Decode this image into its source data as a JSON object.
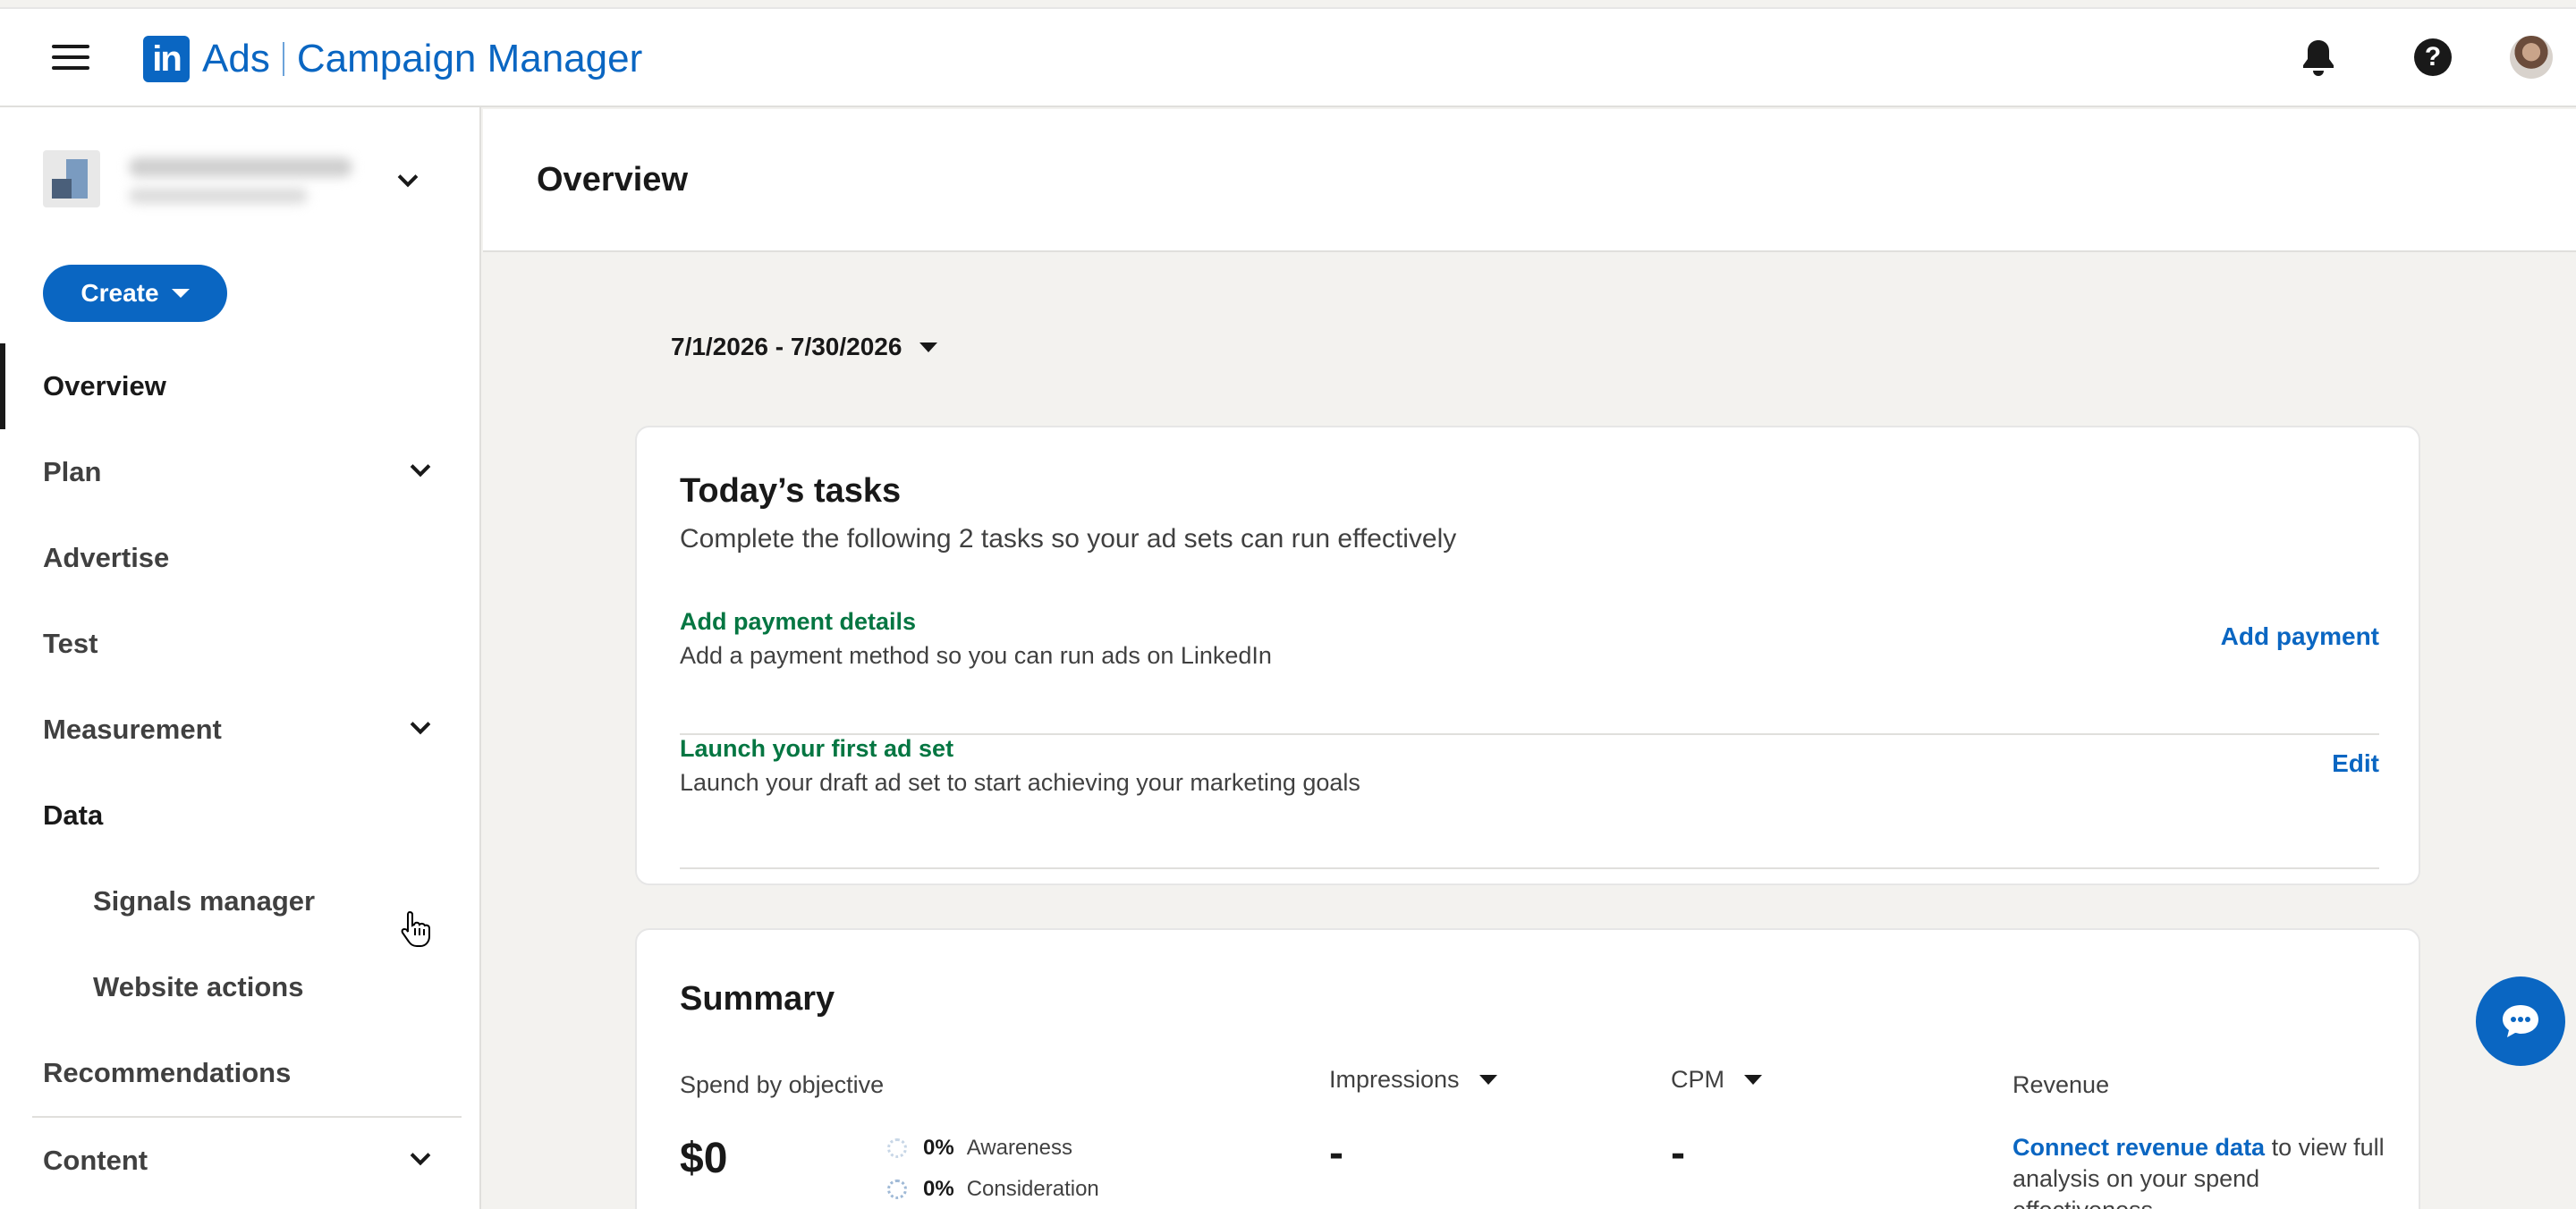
{
  "header": {
    "logo_text": "in",
    "brand_ads": "Ads",
    "brand_product": "Campaign Manager",
    "icons": [
      "menu-icon",
      "bell-icon",
      "help-icon",
      "avatar"
    ]
  },
  "sidebar": {
    "create_label": "Create",
    "items": [
      {
        "label": "Overview",
        "active": true,
        "expandable": false
      },
      {
        "label": "Plan",
        "expandable": true
      },
      {
        "label": "Advertise",
        "expandable": false
      },
      {
        "label": "Test",
        "expandable": false
      },
      {
        "label": "Measurement",
        "expandable": true
      },
      {
        "label": "Data",
        "expandable": true,
        "expanded": true
      },
      {
        "label": "Signals manager",
        "sub": true
      },
      {
        "label": "Website actions",
        "sub": true
      },
      {
        "label": "Recommendations",
        "expandable": false
      },
      {
        "label": "Content",
        "expandable": true
      }
    ]
  },
  "page": {
    "title": "Overview",
    "date_range": "7/1/2026 - 7/30/2026"
  },
  "tasks": {
    "title": "Today’s tasks",
    "subtitle": "Complete the following 2 tasks so your ad sets can run effectively",
    "items": [
      {
        "title": "Add payment details",
        "desc": "Add a payment method so you can run ads on LinkedIn",
        "action": "Add payment"
      },
      {
        "title": "Launch your first ad set",
        "desc": "Launch your draft ad set to start achieving your marketing goals",
        "action": "Edit"
      }
    ]
  },
  "summary": {
    "title": "Summary",
    "spend_label": "Spend by objective",
    "spend_value": "$0",
    "objectives": [
      {
        "pct": "0%",
        "name": "Awareness"
      },
      {
        "pct": "0%",
        "name": "Consideration"
      }
    ],
    "impressions_label": "Impressions",
    "impressions_value": "-",
    "cpm_label": "CPM",
    "cpm_value": "-",
    "revenue_label": "Revenue",
    "revenue_link": "Connect revenue data",
    "revenue_text": " to view full analysis on your spend effectiveness"
  },
  "colors": {
    "brand": "#0a66c2",
    "task_title": "#057642",
    "background": "#f3f2ef"
  }
}
